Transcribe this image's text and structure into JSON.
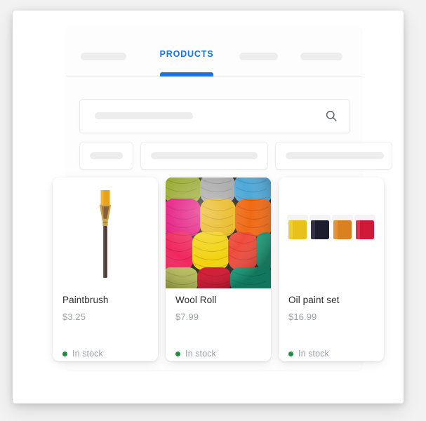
{
  "app": {
    "background_color": "#f2f2f2",
    "card_color": "#ffffff",
    "accent_color": "#1a73e8",
    "stock_color": "#1e8e3e"
  },
  "tabs": {
    "active_label": "PRODUCTS",
    "placeholder_count": 3
  },
  "search": {
    "value": "",
    "placeholder": "",
    "icon": "search-icon"
  },
  "filters": {
    "chip_count": 3
  },
  "products": [
    {
      "title": "Paintbrush",
      "price": "$3.25",
      "stock_label": "In stock",
      "image": "paintbrush",
      "image_style": "contained",
      "colors": {
        "bristle": "#e8a318",
        "ferrule": "#c9a54a",
        "handle": "#4a3b38"
      }
    },
    {
      "title": "Wool Roll",
      "price": "$7.99",
      "stock_label": "In stock",
      "image": "wool-yarn-balls",
      "image_style": "full-bleed",
      "colors": {
        "row1": [
          "#9aab32",
          "#a6a6a6",
          "#4fa8d8"
        ],
        "row2": [
          "#e5197f",
          "#e8b618",
          "#f06a15"
        ],
        "row3": [
          "#f0285f",
          "#f2d211",
          "#ef4b3c",
          "#1f9e7a"
        ],
        "row4": [
          "#b8c05a",
          "#d6132f",
          "#16a07c"
        ]
      }
    },
    {
      "title": "Oil paint set",
      "price": "$16.99",
      "stock_label": "In stock",
      "image": "paint-jars",
      "image_style": "contained",
      "colors": {
        "lid": "#f4f4f4",
        "jars": [
          "#e8c21a",
          "#1c1c2e",
          "#d98020",
          "#d01838"
        ]
      }
    }
  ]
}
